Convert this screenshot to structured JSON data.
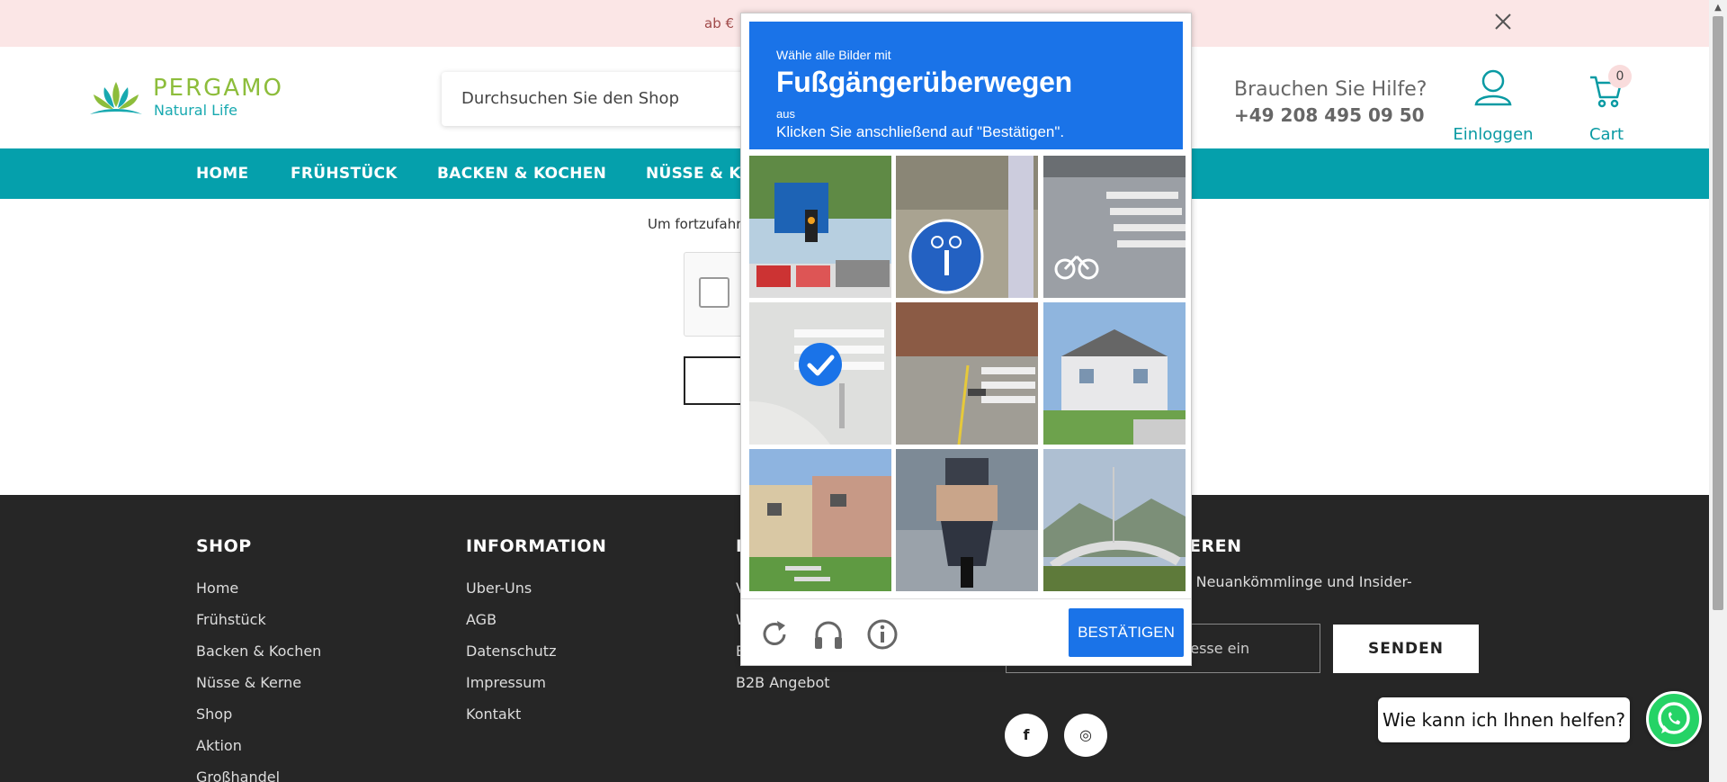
{
  "announcement": {
    "text": "ab €"
  },
  "header": {
    "logo_word": "PERGAMO",
    "logo_sub": "Natural Life",
    "search_placeholder": "Durchsuchen Sie den Shop",
    "help_question": "Brauchen Sie Hilfe?",
    "help_phone": "+49 208 495 09 50",
    "account_label": "Einloggen",
    "cart_label": "Cart",
    "cart_count": "0"
  },
  "nav": {
    "items": [
      "HOME",
      "FRÜHSTÜCK",
      "BACKEN & KOCHEN",
      "NÜSSE & KE"
    ]
  },
  "content": {
    "text": "Um fortzufahr"
  },
  "footer": {
    "shop_heading": "SHOP",
    "shop_links": [
      "Home",
      "Frühstück",
      "Backen & Kochen",
      "Nüsse & Kerne",
      "Shop",
      "Aktion",
      "Großhandel"
    ],
    "info_heading": "INFORMATION",
    "info_links": [
      "Uber-Uns",
      "AGB",
      "Datenschutz",
      "Impressum",
      "Kontakt"
    ],
    "third_heading_partial": "K",
    "third_links": [
      "V",
      "W",
      "B",
      "B2B Angebot"
    ],
    "news_heading_partial": "EREN",
    "news_text": "re Updates, Neuankömmlinge und Insider-",
    "email_placeholder_partial": "resse ein",
    "send_label": "SENDEN",
    "social": [
      "f",
      "◎"
    ]
  },
  "chat": {
    "bubble_text": "Wie kann ich Ihnen helfen?"
  },
  "captcha": {
    "line1": "Wähle alle Bilder mit",
    "keyword": "Fußgängerüberwegen",
    "aus": "aus",
    "instruction": "Klicken Sie anschließend auf \"Bestätigen\".",
    "verify_label": "BESTÄTIGEN",
    "tiles": [
      {
        "name": "street-sign-traffic-light",
        "selected": false
      },
      {
        "name": "bike-pedestrian-sign",
        "selected": false
      },
      {
        "name": "crosswalk-bike-lane",
        "selected": false
      },
      {
        "name": "crosswalk-corner",
        "selected": true
      },
      {
        "name": "crosswalk-bike-path",
        "selected": false
      },
      {
        "name": "house-street",
        "selected": false
      },
      {
        "name": "apartment-buildings",
        "selected": false
      },
      {
        "name": "motorcycle-rider",
        "selected": false
      },
      {
        "name": "bridge-hills",
        "selected": false
      }
    ],
    "icons": [
      "reload-icon",
      "audio-icon",
      "info-icon"
    ]
  }
}
